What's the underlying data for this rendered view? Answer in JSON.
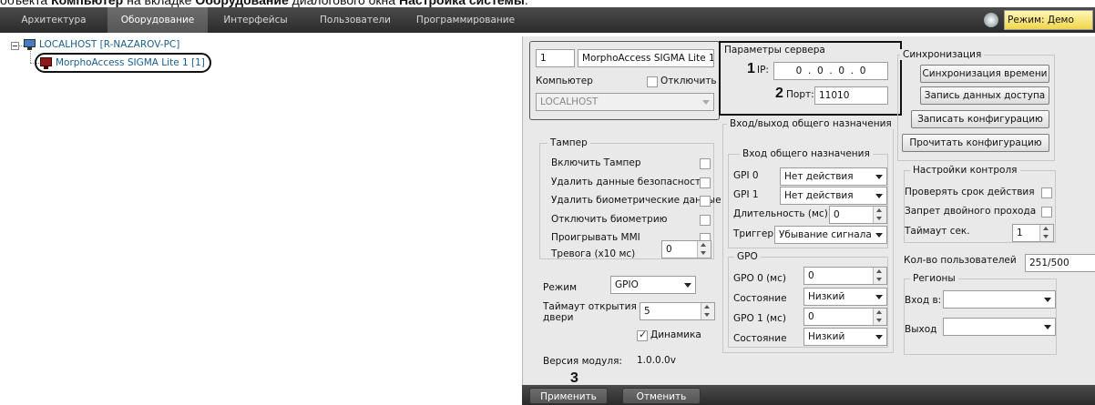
{
  "caption": {
    "prefix": "объекта ",
    "b1": "Компьютер",
    "mid1": " на вкладке ",
    "b2": "Оборудование",
    "mid2": " диалогового окна ",
    "b3": "Настройка системы",
    "end": "."
  },
  "menu": {
    "tabs": [
      "Архитектура",
      "Оборудование",
      "Интерфейсы",
      "Пользователи",
      "Программирование"
    ],
    "mode_label": "Режим: Демо"
  },
  "tree": {
    "root": "LOCALHOST [R-NAZAROV-PC]",
    "child": "MorphoAccess SIGMA Lite 1 [1]"
  },
  "object": {
    "id": "1",
    "name": "MorphoAccess SIGMA Lite 1",
    "computer_label": "Компьютер",
    "disable_label": "Отключить",
    "computer_value": "LOCALHOST"
  },
  "tamper": {
    "title": "Тампер",
    "items": [
      "Включить Тампер",
      "Удалить данные безопасности",
      "Удалить биометрические данные",
      "Отключить биометрию",
      "Проигрывать MMI"
    ],
    "alarm_label": "Тревога (x10 мс)",
    "alarm_value": "0"
  },
  "mode": {
    "label": "Режим",
    "value": "GPIO",
    "timeout_label_1": "Таймаут открытия",
    "timeout_label_2": "двери",
    "timeout_value": "5",
    "dynamic_label": "Динамика"
  },
  "version": {
    "label": "Версия модуля:",
    "value": "1.0.0.0v"
  },
  "server": {
    "title": "Параметры сервера",
    "ip_label": "IP:",
    "ip_octets": [
      "0",
      "0",
      "0",
      "0"
    ],
    "port_label": "Порт:",
    "port_value": "11010"
  },
  "io": {
    "title": "Вход/выход общего назначения",
    "gpi_title": "Вход общего назначения",
    "gpi0_label": "GPI 0",
    "gpi0_value": "Нет действия",
    "gpi1_label": "GPI 1",
    "gpi1_value": "Нет действия",
    "duration_label": "Длительность (мс)",
    "duration_value": "0",
    "trigger_label": "Триггер",
    "trigger_value": "Убывание сигнала",
    "gpo_title": "GPO",
    "gpo0_label": "GPO 0 (мс)",
    "gpo0_value": "0",
    "state_label": "Состояние",
    "state0_value": "Низкий",
    "gpo1_label": "GPO 1 (мс)",
    "gpo1_value": "0",
    "state1_value": "Низкий"
  },
  "sync": {
    "title": "Синхронизация",
    "buttons": [
      "Синхронизация времени",
      "Запись данных доступа",
      "Записать конфигурацию",
      "Прочитать конфигурацию"
    ]
  },
  "control": {
    "title": "Настройки контроля",
    "check_validity": "Проверять срок действия",
    "double_pass": "Запрет двойного прохода",
    "timeout_label": "Таймаут сек.",
    "timeout_value": "1"
  },
  "users": {
    "label": "Кол-во пользователей",
    "value": "251/500"
  },
  "regions": {
    "title": "Регионы",
    "enter_label": "Вход в:",
    "exit_label": "Выход"
  },
  "callouts": {
    "n1": "1",
    "n2": "2",
    "n3": "3"
  },
  "actions": {
    "apply": "Применить",
    "cancel": "Отменить"
  }
}
